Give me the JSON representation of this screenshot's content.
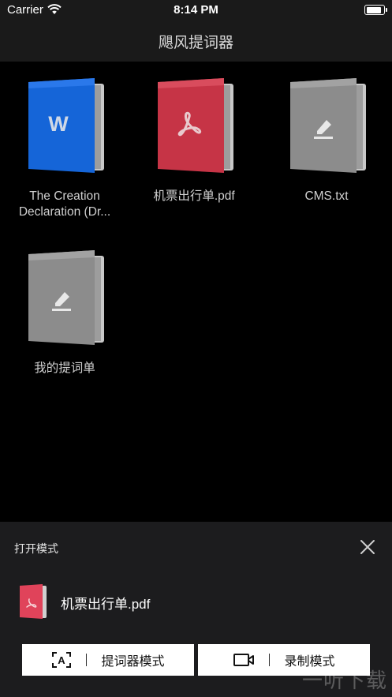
{
  "status_bar": {
    "carrier": "Carrier",
    "time": "8:14 PM",
    "battery_level": 1.0
  },
  "nav": {
    "title": "飓风提词器"
  },
  "files": [
    {
      "name": "The Creation Declaration (Dr...",
      "type": "word",
      "glyph": "W",
      "color": "#1565d8",
      "icon": "word-doc-icon"
    },
    {
      "name": "机票出行单.pdf",
      "type": "pdf",
      "color": "#cc3344",
      "icon": "pdf-doc-icon"
    },
    {
      "name": "CMS.txt",
      "type": "txt",
      "color": "#8e8e8e",
      "icon": "text-doc-icon"
    },
    {
      "name": "我的提词单",
      "type": "txt",
      "color": "#8e8e8e",
      "icon": "text-doc-icon"
    }
  ],
  "sheet": {
    "title": "打开模式",
    "file_name": "机票出行单.pdf",
    "buttons": [
      {
        "label": "提词器模式",
        "icon": "text-frame-icon"
      },
      {
        "label": "录制模式",
        "icon": "video-camera-icon"
      }
    ]
  },
  "watermark": "一听下载"
}
